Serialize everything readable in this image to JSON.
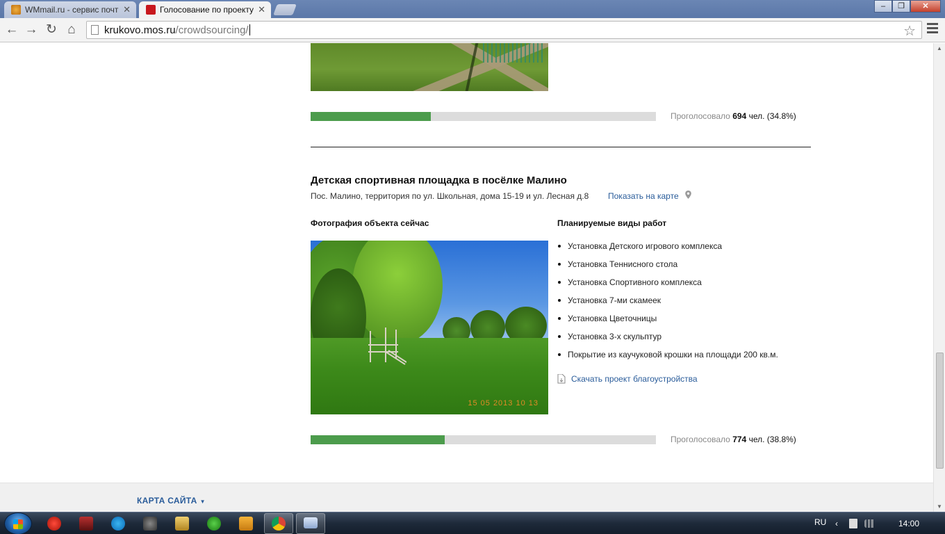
{
  "browser": {
    "tabs": [
      {
        "title": "WMmail.ru - сервис почт",
        "active": false
      },
      {
        "title": "Голосование по проекту",
        "active": true
      }
    ],
    "url_host": "krukovo.mos.ru",
    "url_path": "/crowdsourcing/"
  },
  "colors": {
    "progress_fill": "#4c9c4c",
    "progress_track": "#dcdcdc",
    "link": "#2a5c9a"
  },
  "previous_project": {
    "votes_label": "Проголосовало",
    "votes_count": "694",
    "votes_unit": "чел.",
    "votes_percent": "(34.8%)",
    "progress": 0.348
  },
  "project": {
    "title": "Детская спортивная площадка в посёлке Малино",
    "address": "Пос. Малино, территория по ул. Школьная, дома 15-19 и ул. Лесная д.8",
    "map_link": "Показать на карте",
    "photo_heading": "Фотография объекта сейчас",
    "photo_stamp": "15 05 2013 10 13",
    "works_heading": "Планируемые виды работ",
    "works": [
      "Установка Детского игрового комплекса",
      "Установка Теннисного стола",
      "Установка Спортивного комплекса",
      "Установка 7-ми скамеек",
      "Установка Цветочницы",
      "Установка 3-х скульптур",
      "Покрытие из каучуковой крошки на площади 200 кв.м."
    ],
    "download_link": "Скачать проект благоустройства",
    "votes_label": "Проголосовало",
    "votes_count": "774",
    "votes_unit": "чел.",
    "votes_percent": "(38.8%)",
    "progress": 0.388
  },
  "footer": {
    "sitemap": "КАРТА САЙТА"
  },
  "taskbar": {
    "language": "RU",
    "clock": "14:00"
  }
}
